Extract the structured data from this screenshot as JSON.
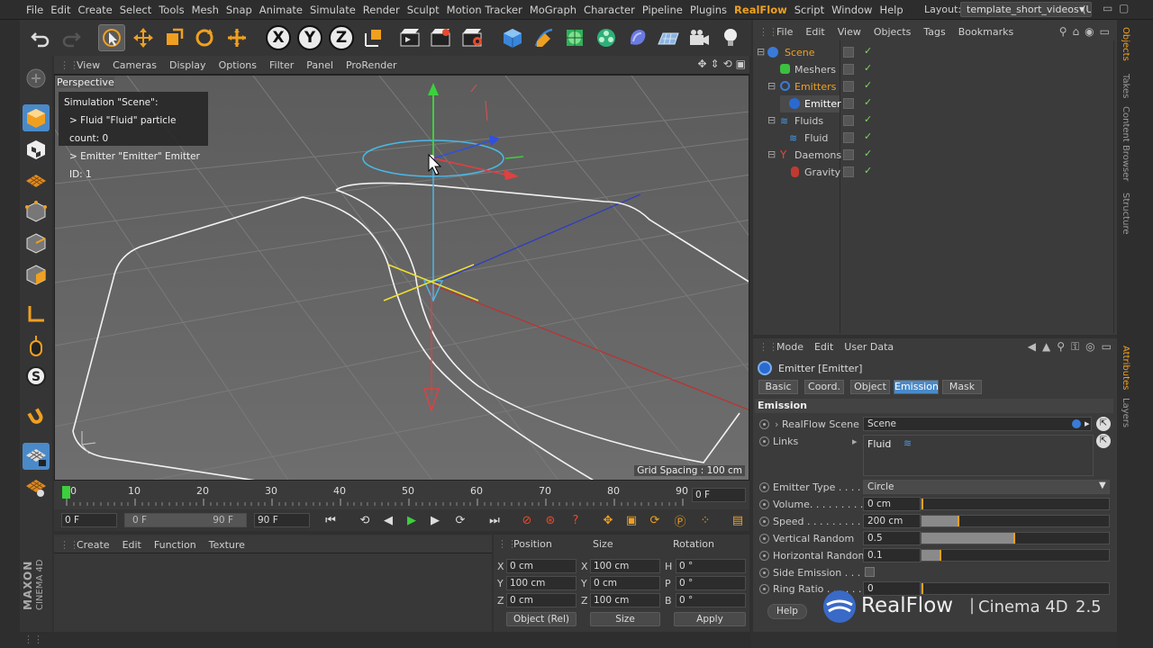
{
  "menubar": {
    "items": [
      "File",
      "Edit",
      "Create",
      "Select",
      "Tools",
      "Mesh",
      "Snap",
      "Animate",
      "Simulate",
      "Render",
      "Sculpt",
      "Motion Tracker",
      "MoGraph",
      "Character",
      "Pipeline",
      "Plugins",
      "RealFlow",
      "Script",
      "Window",
      "Help"
    ],
    "highlight": "RealFlow",
    "layout_label": "Layout:",
    "layout_value": "template_short_videos (User)"
  },
  "viewport": {
    "menu": [
      "View",
      "Cameras",
      "Display",
      "Options",
      "Filter",
      "Panel",
      "ProRender"
    ],
    "camera": "Perspective",
    "sim_title": "Simulation \"Scene\":",
    "sim_line1": "> Fluid \"Fluid\" particle count: 0",
    "sim_line2": "> Emitter \"Emitter\" Emitter ID: 1",
    "grid_spacing": "Grid Spacing : 100 cm"
  },
  "timeline": {
    "ticks": [
      "0",
      "10",
      "20",
      "30",
      "40",
      "50",
      "60",
      "70",
      "80",
      "90"
    ],
    "current_frame": "0 F",
    "start": "0 F",
    "range_start": "0 F",
    "range_end": "90 F",
    "end": "90 F"
  },
  "materials": {
    "menu": [
      "Create",
      "Edit",
      "Function",
      "Texture"
    ]
  },
  "coords": {
    "headers": [
      "Position",
      "Size",
      "Rotation"
    ],
    "pos": {
      "x": "0 cm",
      "y": "100 cm",
      "z": "0 cm"
    },
    "size": {
      "x": "100 cm",
      "y": "0 cm",
      "z": "100 cm"
    },
    "rot": {
      "h": "0 °",
      "p": "0 °",
      "b": "0 °"
    },
    "mode": "Object (Rel)",
    "size_mode": "Size",
    "apply": "Apply"
  },
  "objects": {
    "menu": [
      "File",
      "Edit",
      "View",
      "Objects",
      "Tags",
      "Bookmarks"
    ],
    "tree": [
      {
        "name": "Scene",
        "indent": 0,
        "state": "sel"
      },
      {
        "name": "Meshers",
        "indent": 1,
        "state": ""
      },
      {
        "name": "Emitters",
        "indent": 1,
        "state": "sel"
      },
      {
        "name": "Emitter",
        "indent": 2,
        "state": "act"
      },
      {
        "name": "Fluids",
        "indent": 1,
        "state": ""
      },
      {
        "name": "Fluid",
        "indent": 2,
        "state": ""
      },
      {
        "name": "Daemons",
        "indent": 1,
        "state": ""
      },
      {
        "name": "Gravity",
        "indent": 2,
        "state": ""
      }
    ],
    "side_tabs": [
      "Objects",
      "Takes",
      "Content Browser",
      "Structure"
    ]
  },
  "attributes": {
    "menu": [
      "Mode",
      "Edit",
      "User Data"
    ],
    "object_title": "Emitter [Emitter]",
    "tabs": [
      "Basic",
      "Coord.",
      "Object",
      "Emission",
      "Mask"
    ],
    "active_tab": "Emission",
    "section": "Emission",
    "realflow_scene_label": "RealFlow Scene",
    "realflow_scene_value": "Scene",
    "links_label": "Links",
    "links_value": "Fluid",
    "emitter_type_label": "Emitter Type . . . . .",
    "emitter_type_value": "Circle",
    "volume_label": "Volume. . . . . . . . .",
    "volume_value": "0 cm",
    "speed_label": "Speed . . . . . . . . .",
    "speed_value": "200 cm",
    "vrandom_label": "Vertical Random",
    "vrandom_value": "0.5",
    "hrandom_label": "Horizontal Random",
    "hrandom_value": "0.1",
    "side_emission_label": "Side Emission . . . .",
    "ring_ratio_label": "Ring Ratio . . . . . .",
    "ring_ratio_value": "0",
    "help": "Help",
    "side_tabs": [
      "Attributes",
      "Layers"
    ]
  },
  "sliders": {
    "volume": 0.0,
    "speed": 0.2,
    "vrandom": 0.5,
    "hrandom": 0.1,
    "ring_ratio": 0.0
  },
  "branding": {
    "product": "RealFlow",
    "separator": "|",
    "host": "Cinema 4D",
    "version": "2.5",
    "vendor": "MAXON",
    "app": "CINEMA 4D"
  },
  "colors": {
    "accent": "#f0a020",
    "selection": "#4a8ac8",
    "check": "#7dd860"
  }
}
